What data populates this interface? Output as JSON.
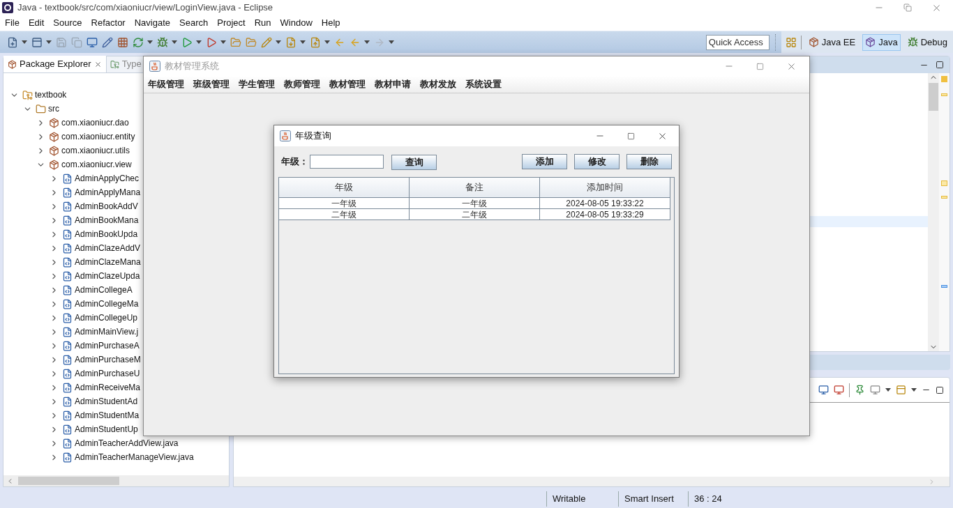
{
  "window": {
    "title": "Java - textbook/src/com/xiaoniucr/view/LoginView.java - Eclipse"
  },
  "menu": [
    "File",
    "Edit",
    "Source",
    "Refactor",
    "Navigate",
    "Search",
    "Project",
    "Run",
    "Window",
    "Help"
  ],
  "quick_access": {
    "placeholder": "Quick Access"
  },
  "perspectives": [
    {
      "label": "Java EE",
      "selected": false
    },
    {
      "label": "Java",
      "selected": true
    },
    {
      "label": "Debug",
      "selected": false
    }
  ],
  "package_explorer": {
    "tabs": [
      {
        "label": "Package Explorer",
        "selected": true
      },
      {
        "label": "Type",
        "selected": false
      }
    ],
    "tree": [
      {
        "label": "textbook",
        "kind": "project",
        "expanded": true,
        "children": [
          {
            "label": "src",
            "kind": "folder",
            "expanded": true,
            "children": [
              {
                "label": "com.xiaoniucr.dao",
                "kind": "package",
                "expanded": false
              },
              {
                "label": "com.xiaoniucr.entity",
                "kind": "package",
                "expanded": false
              },
              {
                "label": "com.xiaoniucr.utils",
                "kind": "package",
                "expanded": false
              },
              {
                "label": "com.xiaoniucr.view",
                "kind": "package",
                "expanded": true,
                "children": [
                  {
                    "label": "AdminApplyChec",
                    "kind": "file",
                    "expanded": false
                  },
                  {
                    "label": "AdminApplyMana",
                    "kind": "file",
                    "expanded": false
                  },
                  {
                    "label": "AdminBookAddV",
                    "kind": "file",
                    "expanded": false
                  },
                  {
                    "label": "AdminBookMana",
                    "kind": "file",
                    "expanded": false
                  },
                  {
                    "label": "AdminBookUpda",
                    "kind": "file",
                    "expanded": false
                  },
                  {
                    "label": "AdminClazeAddV",
                    "kind": "file",
                    "expanded": false
                  },
                  {
                    "label": "AdminClazeMana",
                    "kind": "file",
                    "expanded": false
                  },
                  {
                    "label": "AdminClazeUpda",
                    "kind": "file",
                    "expanded": false
                  },
                  {
                    "label": "AdminCollegeA",
                    "kind": "file",
                    "expanded": false
                  },
                  {
                    "label": "AdminCollegeMa",
                    "kind": "file",
                    "expanded": false
                  },
                  {
                    "label": "AdminCollegeUp",
                    "kind": "file",
                    "expanded": false
                  },
                  {
                    "label": "AdminMainView.j",
                    "kind": "file",
                    "expanded": false
                  },
                  {
                    "label": "AdminPurchaseA",
                    "kind": "file",
                    "expanded": false
                  },
                  {
                    "label": "AdminPurchaseM",
                    "kind": "file",
                    "expanded": false
                  },
                  {
                    "label": "AdminPurchaseU",
                    "kind": "file",
                    "expanded": false
                  },
                  {
                    "label": "AdminReceiveMa",
                    "kind": "file",
                    "expanded": false
                  },
                  {
                    "label": "AdminStudentAd",
                    "kind": "file",
                    "expanded": false
                  },
                  {
                    "label": "AdminStudentMa",
                    "kind": "file",
                    "expanded": false
                  },
                  {
                    "label": "AdminStudentUp",
                    "kind": "file",
                    "expanded": false
                  },
                  {
                    "label": "AdminTeacherAddView.java",
                    "kind": "file",
                    "expanded": false
                  },
                  {
                    "label": "AdminTeacherManageView.java",
                    "kind": "file",
                    "expanded": false
                  }
                ]
              }
            ]
          }
        ]
      }
    ]
  },
  "status_bar": [
    "Writable",
    "Smart Insert",
    "36 : 24"
  ],
  "app_frame": {
    "title": "教材管理系统",
    "menu": [
      "年级管理",
      "班级管理",
      "学生管理",
      "教师管理",
      "教材管理",
      "教材申请",
      "教材发放",
      "系统设置"
    ]
  },
  "dialog": {
    "title": "年级查询",
    "search_label": "年级：",
    "search_button": "查询",
    "buttons": [
      "添加",
      "修改",
      "删除"
    ],
    "table": {
      "columns": [
        "年级",
        "备注",
        "添加时间"
      ],
      "rows": [
        [
          "一年级",
          "一年级",
          "2024-08-05 19:33:22"
        ],
        [
          "二年级",
          "二年级",
          "2024-08-05 19:33:29"
        ]
      ]
    }
  }
}
